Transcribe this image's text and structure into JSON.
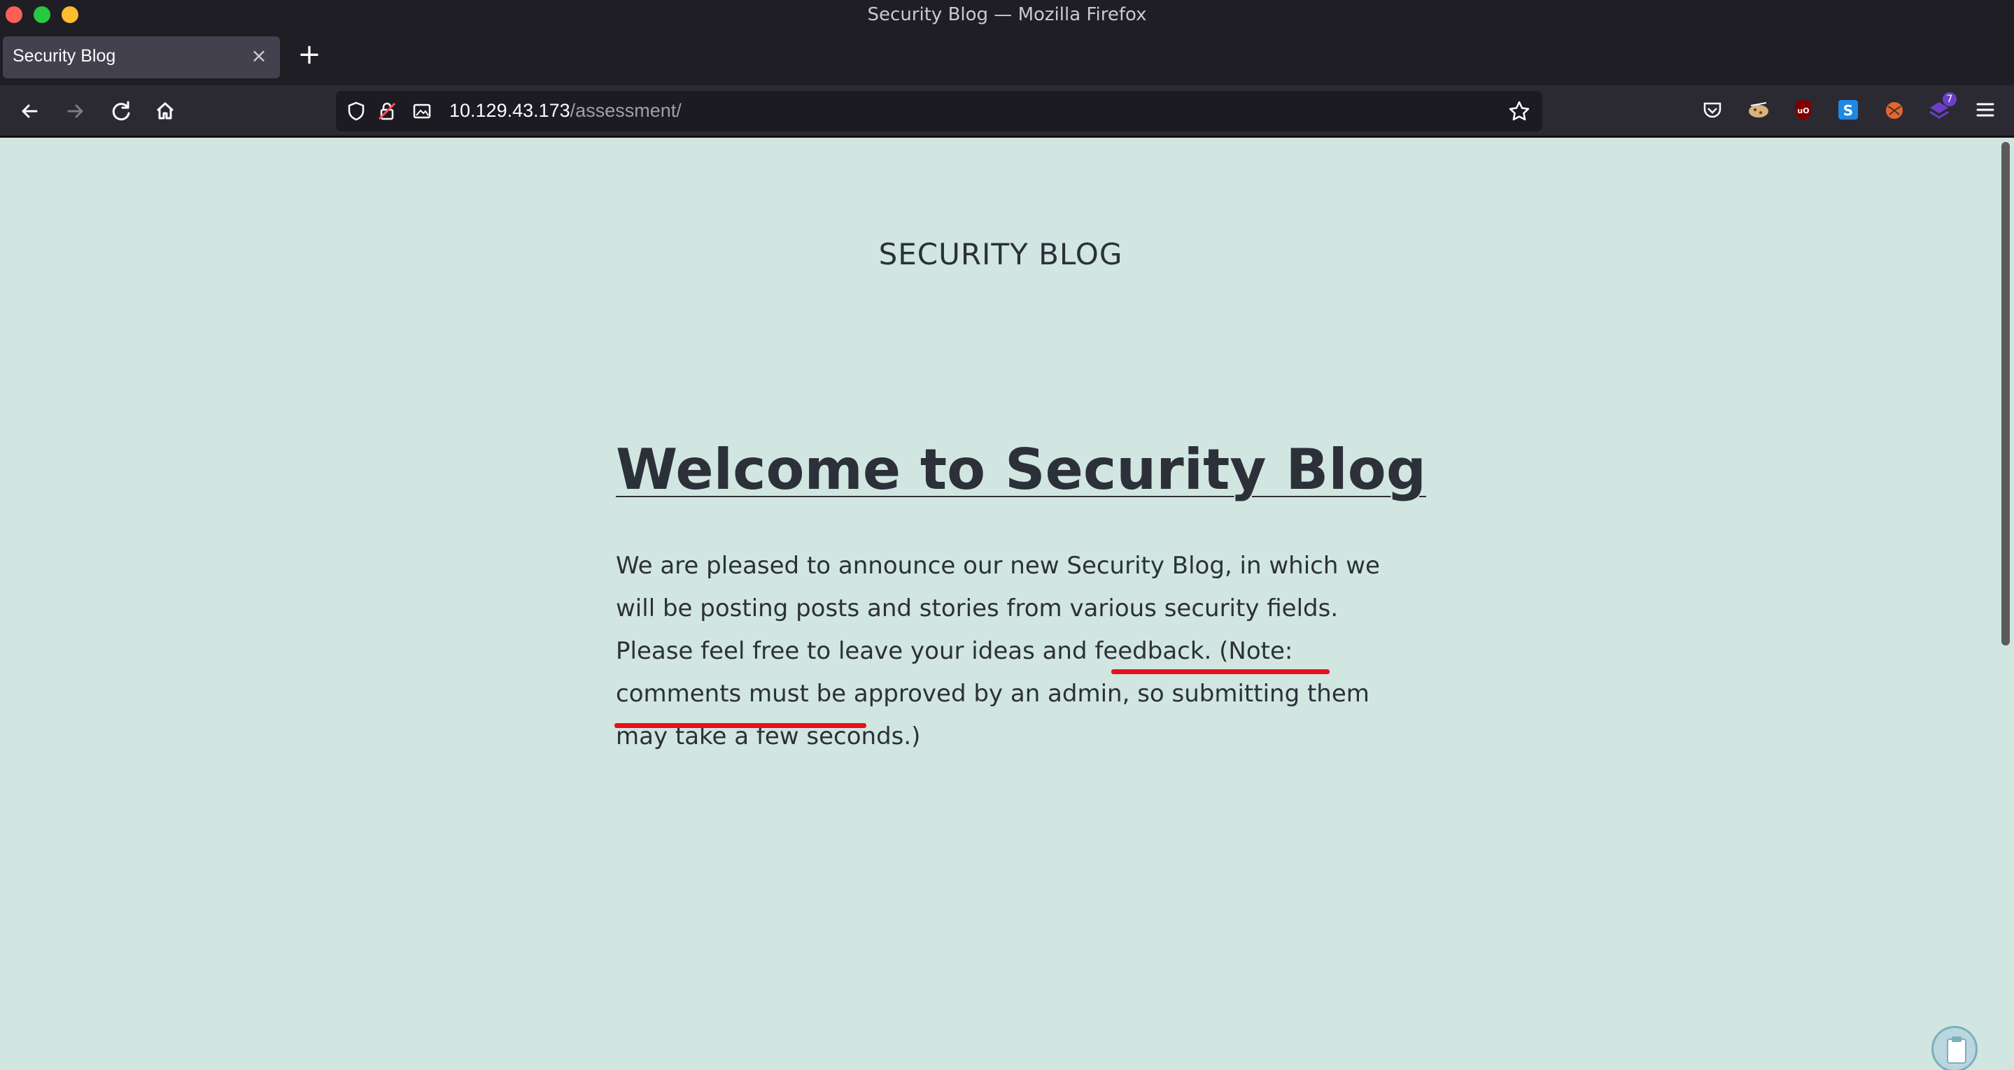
{
  "window": {
    "title": "Security Blog — Mozilla Firefox"
  },
  "tabs": [
    {
      "label": "Security Blog",
      "close_glyph": "×"
    }
  ],
  "new_tab_glyph": "+",
  "navbar": {
    "url_host": "10.129.43.173",
    "url_path": "/assessment/",
    "extensions": [
      "pocket-icon",
      "cookie-editor-icon",
      "ublock-origin-icon",
      "s-extension-icon",
      "foxyproxy-icon",
      "wappalyzer-icon"
    ],
    "extension_badge": "7"
  },
  "page": {
    "site_header": "SECURITY BLOG",
    "post_title": "Welcome to Security Blog",
    "post_body": "We are pleased to announce our new Security Blog, in which we will be posting posts and stories from various security fields. Please feel free to leave your ideas and feedback. (Note: comments must be approved by an admin, so submitting them may take a few seconds.)"
  },
  "colors": {
    "page_background": "#d1e6e0",
    "text": "#2c3039",
    "annotation": "#e8101c",
    "toolbar": "#2b2a33"
  }
}
